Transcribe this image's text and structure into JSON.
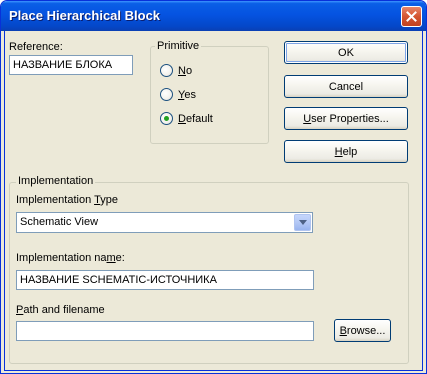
{
  "window": {
    "title": "Place Hierarchical Block"
  },
  "reference": {
    "label": "Reference:",
    "value": "НАЗВАНИЕ БЛОКА"
  },
  "primitive": {
    "title": "Primitive",
    "options": [
      {
        "label": "No",
        "accel": "N",
        "rest": "o",
        "selected": false
      },
      {
        "label": "Yes",
        "accel": "Y",
        "rest": "es",
        "selected": false
      },
      {
        "label": "Default",
        "accel": "D",
        "rest": "efault",
        "selected": true
      }
    ]
  },
  "buttons": {
    "ok": "OK",
    "cancel": "Cancel",
    "user_properties": {
      "accel": "U",
      "rest": "ser Properties..."
    },
    "help": {
      "accel": "H",
      "rest": "elp"
    },
    "browse": {
      "accel": "B",
      "rest": "rowse..."
    }
  },
  "implementation": {
    "title": "Implementation",
    "type_label": {
      "before": "Implementation ",
      "accel": "T",
      "after": "ype"
    },
    "type_value": "Schematic View",
    "name_label": {
      "before": "Implementation na",
      "accel": "m",
      "after": "e:"
    },
    "name_value": "НАЗВАНИЕ SCHEMATIC-ИСТОЧНИКА",
    "path_label": {
      "accel": "P",
      "rest": "ath and filename"
    },
    "path_value": ""
  },
  "icons": {
    "close": "close-icon",
    "dropdown": "chevron-down-icon"
  },
  "colors": {
    "title_bar": "#0553e1",
    "close_button": "#d45531",
    "dialog_bg": "#ece9d8",
    "radio_dot": "#21a121"
  }
}
